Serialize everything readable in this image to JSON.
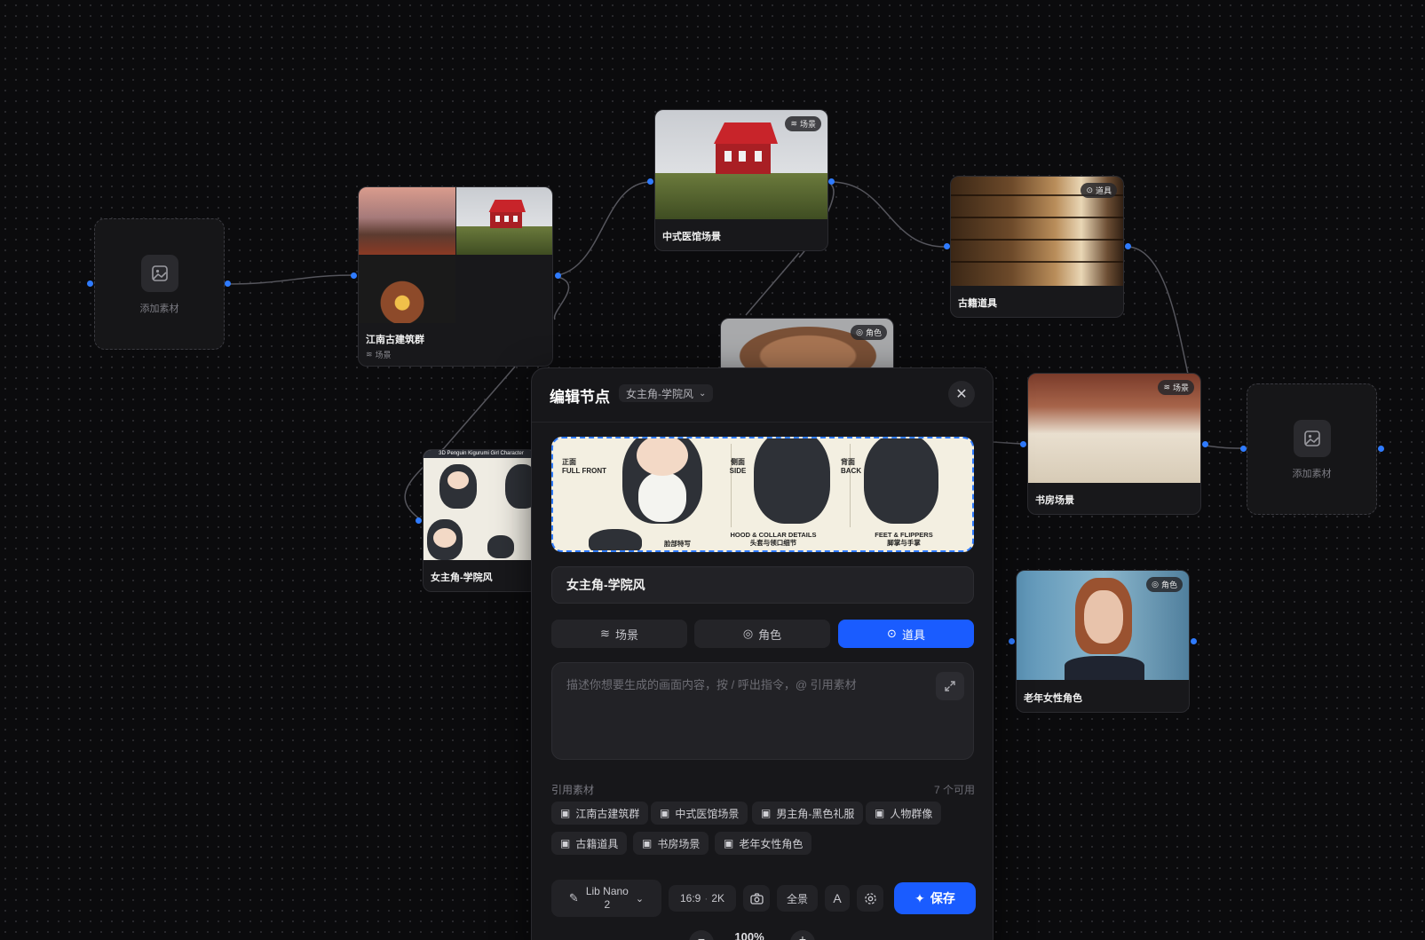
{
  "canvas": {
    "nodes": {
      "add_left": {
        "label": "添加素材"
      },
      "add_right": {
        "label": "添加素材"
      },
      "jiangnan": {
        "title": "江南古建筑群",
        "sub": "场景"
      },
      "clinic": {
        "title": "中式医馆场景",
        "badge": "场景"
      },
      "books": {
        "title": "古籍道具",
        "badge": "道具"
      },
      "man": {
        "badge": "角色"
      },
      "study": {
        "title": "书房场景",
        "badge": "场景"
      },
      "heroine": {
        "title": "女主角-学院风",
        "image_caption": "3D Penguin Kigurumi Girl Character"
      },
      "woman": {
        "title": "老年女性角色",
        "badge": "角色"
      }
    },
    "accent": "#2f7bff"
  },
  "editor": {
    "title": "编辑节点",
    "breadcrumb": "女主角-学院风",
    "preview": {
      "front_cn": "正面",
      "front_en": "FULL FRONT",
      "side_cn": "侧面",
      "side_en": "SIDE",
      "back_cn": "背面",
      "back_en": "BACK",
      "face_cap": "脸部特写",
      "hood_en": "HOOD & COLLAR DETAILS",
      "hood_cn": "头套与领口细节",
      "feet_en": "FEET & FLIPPERS",
      "feet_cn": "脚掌与手掌"
    },
    "name_value": "女主角-学院风",
    "types": [
      "场景",
      "角色",
      "道具"
    ],
    "active_type": "道具",
    "prompt_placeholder": "描述你想要生成的画面内容，按 / 呼出指令，@ 引用素材",
    "refs": {
      "title": "引用素材",
      "count": "7 个可用",
      "items": [
        "江南古建筑群",
        "中式医馆场景",
        "男主角-黑色礼服",
        "人物群像",
        "古籍道具",
        "书房场景",
        "老年女性角色"
      ]
    },
    "toolbar": {
      "model_line1": "Lib Nano",
      "model_line2": "2",
      "ratio": "16:9",
      "ratio_sep": "·",
      "resolution": "2K",
      "view": "全景",
      "text_tool": "A",
      "save": "保存"
    },
    "primary_color": "#1a5cff"
  },
  "zoom": {
    "value": "100%"
  }
}
